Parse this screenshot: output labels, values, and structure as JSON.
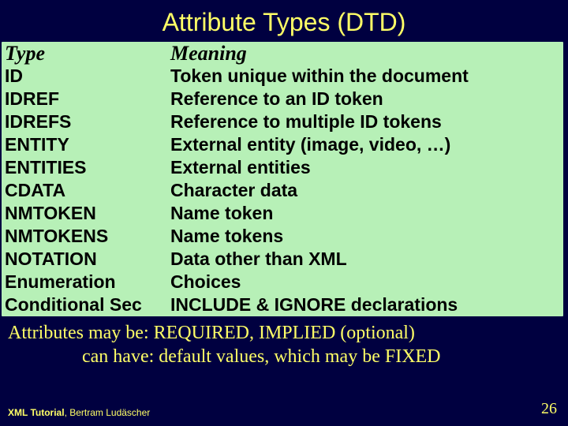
{
  "title": "Attribute Types (DTD)",
  "headers": {
    "type": "Type",
    "meaning": "Meaning"
  },
  "rows": [
    {
      "type": "ID",
      "meaning": "Token unique within the document"
    },
    {
      "type": "IDREF",
      "meaning": "Reference to an ID token"
    },
    {
      "type": "IDREFS",
      "meaning": "Reference to multiple ID tokens"
    },
    {
      "type": "ENTITY",
      "meaning": "External entity (image, video, …)"
    },
    {
      "type": "ENTITIES",
      "meaning": "External entities"
    },
    {
      "type": "CDATA",
      "meaning": "Character data"
    },
    {
      "type": "NMTOKEN",
      "meaning": "Name token"
    },
    {
      "type": "NMTOKENS",
      "meaning": "Name tokens"
    },
    {
      "type": "NOTATION",
      "meaning": "Data other than XML"
    },
    {
      "type": "Enumeration",
      "meaning": "Choices"
    },
    {
      "type": "Conditional Sec",
      "meaning": "INCLUDE & IGNORE declarations"
    }
  ],
  "notes": {
    "line1": "Attributes may be:  REQUIRED, IMPLIED (optional)",
    "line2": "can have:  default values, which may be FIXED"
  },
  "footer": {
    "left_title": "XML Tutorial",
    "left_author": ", Bertram Ludäscher",
    "page": "26"
  }
}
